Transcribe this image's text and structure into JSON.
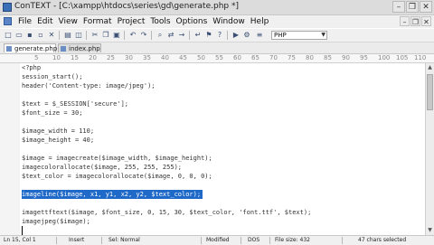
{
  "window": {
    "title": "ConTEXT - [C:\\xampp\\htdocs\\series\\gd\\generate.php *]",
    "controls": {
      "minimize": "–",
      "restore": "❐",
      "close": "✕"
    }
  },
  "menubar": {
    "items": [
      "File",
      "Edit",
      "View",
      "Format",
      "Project",
      "Tools",
      "Options",
      "Window",
      "Help"
    ],
    "mdi_controls": {
      "minimize": "–",
      "restore": "❐",
      "close": "✕"
    }
  },
  "toolbar": {
    "language": "PHP"
  },
  "tabs": [
    {
      "label": "generate.php *",
      "active": true
    },
    {
      "label": "index.php",
      "active": false
    }
  ],
  "ruler": {
    "marks": [
      "5",
      "10",
      "15",
      "20",
      "25",
      "30",
      "35",
      "40",
      "45",
      "50",
      "55",
      "60",
      "65",
      "70",
      "75",
      "80",
      "85",
      "90",
      "95",
      "100",
      "105",
      "110"
    ]
  },
  "editor": {
    "lines": [
      "<?php",
      "session_start();",
      "header('Content-type: image/jpeg');",
      "",
      "$text = $_SESSION['secure'];",
      "$font_size = 30;",
      "",
      "$image_width = 110;",
      "$image_height = 40;",
      "",
      "$image = imagecreate($image_width, $image_height);",
      "imagecolorallocate($image, 255, 255, 255);",
      "$text_color = imagecolorallocate($image, 0, 0, 0);",
      "",
      "imageline($image, x1, y1, x2, y2, $text_color);",
      "",
      "imagettftext($image, $font_size, 0, 15, 30, $text_color, 'font.ttf', $text);",
      "imagejpeg($image);",
      ""
    ],
    "selected_line_index": 14,
    "caret_line_index": 18
  },
  "statusbar": {
    "position": "Ln 15, Col 1",
    "insert_mode": "Insert",
    "sel_mode": "Sel: Normal",
    "modified": "Modified",
    "encoding": "DOS",
    "file_size": "File size: 432",
    "chars_selected": "47 chars selected"
  },
  "colors": {
    "selection": "#1f69c8",
    "chrome": "#f0f0f0",
    "code_text": "#333333"
  }
}
